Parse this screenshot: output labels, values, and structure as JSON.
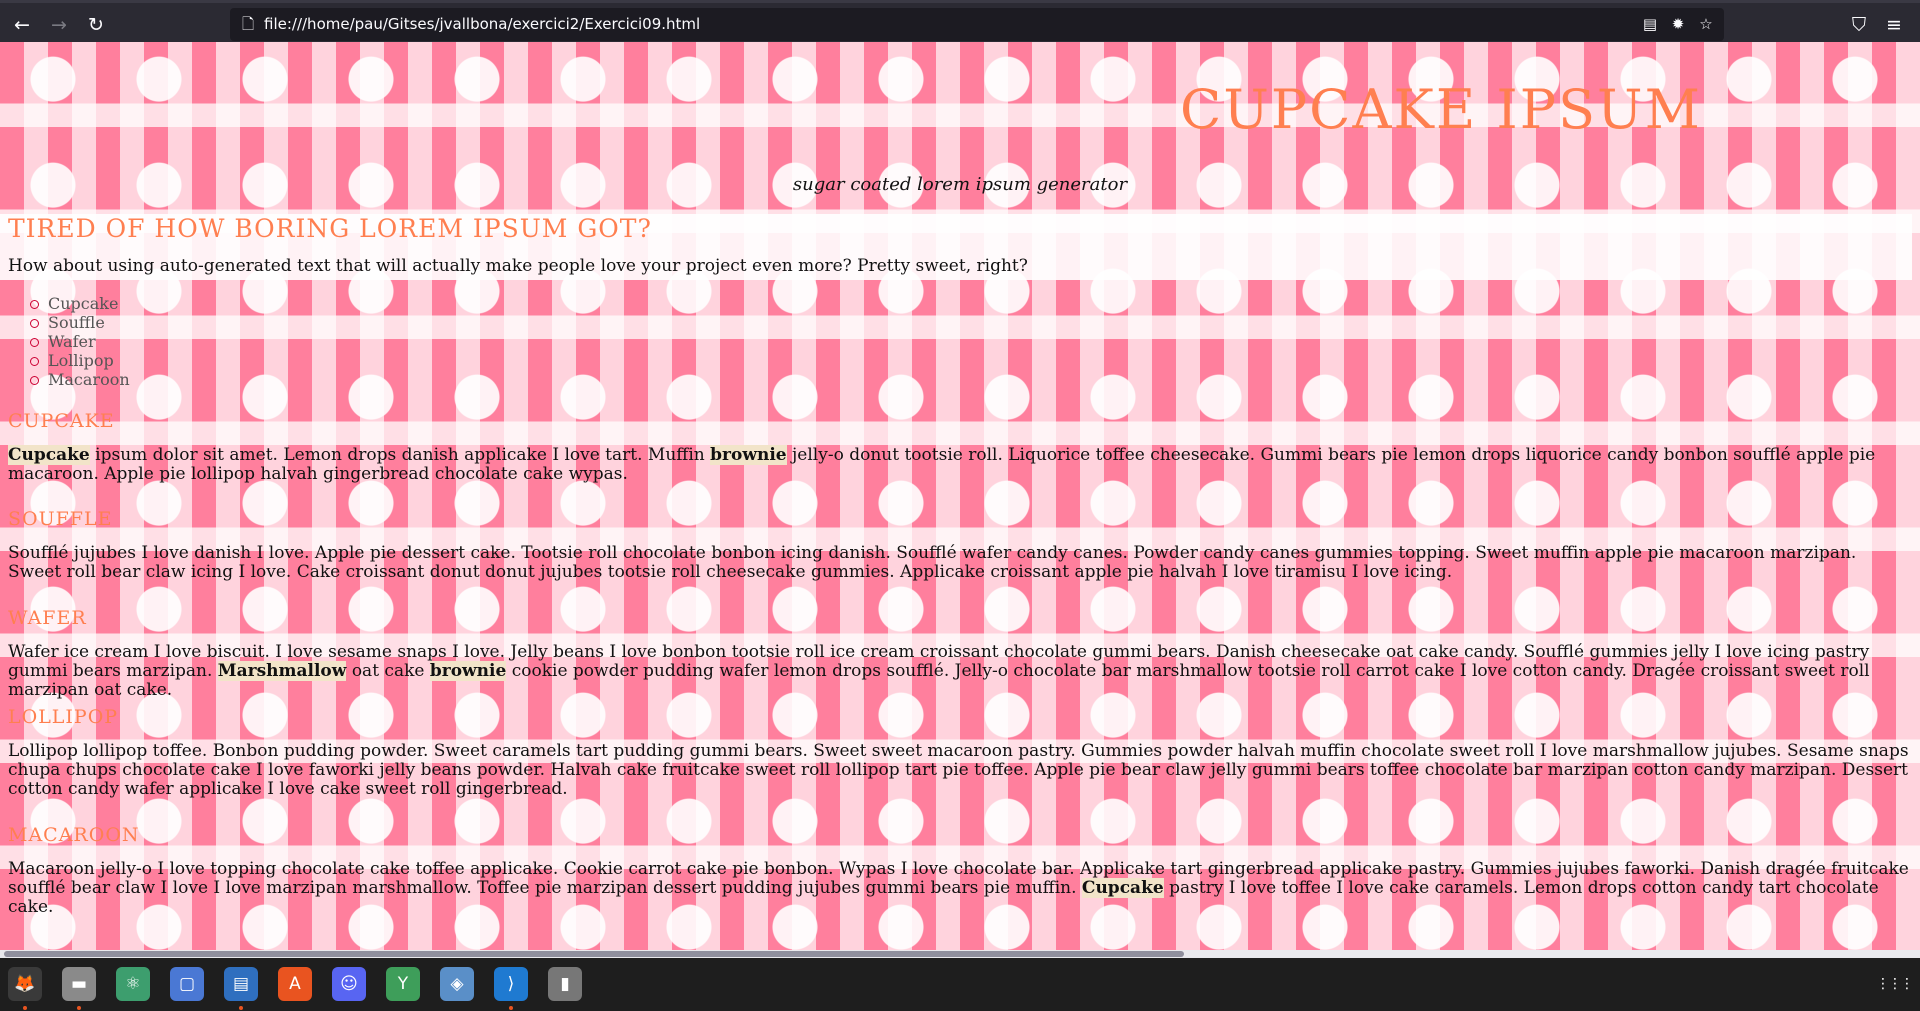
{
  "browser": {
    "url": "file:///home/pau/Gitses/jvallbona/exercici2/Exercici09.html",
    "back_glyph": "←",
    "forward_glyph": "→",
    "reload_glyph": "↻",
    "page_icon": "🗋",
    "reader_icon": "▤",
    "extension_icon": "✹",
    "bookmark_icon": "☆",
    "pocket_icon": "⛉",
    "menu_icon": "≡"
  },
  "page": {
    "title": "CUPCAKE IPSUM",
    "tagline": "sugar coated lorem ipsum generator",
    "intro_heading": "TIRED OF HOW BORING LOREM IPSUM GOT?",
    "intro_text": "How about using auto-generated text that will actually make people love your project even more? Pretty sweet, right?",
    "toc": [
      "Cupcake",
      "Souffle",
      "Wafer",
      "Lollipop",
      "Macaroon"
    ],
    "sections": [
      {
        "heading": "CUPCAKE",
        "p1": "Cupcake",
        "p2": " ipsum dolor sit amet. Lemon drops danish applicake I love tart. Muffin ",
        "p3": "brownie",
        "p4": " jelly-o donut tootsie roll. Liquorice toffee cheesecake. Gummi bears pie lemon drops liquorice candy bonbon soufflé apple pie macaroon. Apple pie lollipop halvah gingerbread chocolate cake wypas."
      },
      {
        "heading": "SOUFFLE",
        "text": "Soufflé jujubes I love danish I love. Apple pie dessert cake. Tootsie roll chocolate bonbon icing danish. Soufflé wafer candy canes. Powder candy canes gummies topping. Sweet muffin apple pie macaroon marzipan. Sweet roll bear claw icing I love. Cake croissant donut donut jujubes tootsie roll cheesecake gummies. Applicake croissant apple pie halvah I love tiramisu I love icing."
      },
      {
        "heading": "WAFER",
        "p1": "Wafer ice cream I love biscuit. I love sesame snaps I love. Jelly beans I love bonbon tootsie roll ice cream croissant chocolate gummi bears. Danish cheesecake oat cake candy. Soufflé gummies jelly I love icing pastry gummi bears marzipan. ",
        "p2": "Marshmallow",
        "p3": " oat cake ",
        "p4": "brownie",
        "p5": " cookie powder pudding wafer lemon drops soufflé. Jelly-o chocolate bar marshmallow tootsie roll carrot cake I love cotton candy. Dragée croissant sweet roll marzipan oat cake."
      },
      {
        "heading": "LOLLIPOP",
        "text": "Lollipop lollipop toffee. Bonbon pudding powder. Sweet caramels tart pudding gummi bears. Sweet sweet macaroon pastry. Gummies powder halvah muffin chocolate sweet roll I love marshmallow jujubes. Sesame snaps chupa chups chocolate cake I love faworki jelly beans powder. Halvah cake fruitcake sweet roll lollipop tart pie toffee. Apple pie bear claw jelly gummi bears toffee chocolate bar marzipan cotton candy marzipan. Dessert cotton candy wafer applicake I love cake sweet roll gingerbread."
      },
      {
        "heading": "MACAROON",
        "p1": "Macaroon jelly-o I love topping chocolate cake toffee applicake. Cookie carrot cake pie bonbon. Wypas I love chocolate bar. Applicake tart gingerbread applicake pastry. Gummies jujubes faworki. Danish dragée fruitcake soufflé bear claw I love I love marzipan marshmallow. Toffee pie marzipan dessert pudding jujubes gummi bears pie muffin. ",
        "p2": "Cupcake",
        "p3": " pastry I love toffee I love cake caramels. Lemon drops cotton candy tart chocolate cake."
      }
    ]
  },
  "taskbar": {
    "apps": [
      {
        "name": "firefox-icon",
        "glyph": "🦊",
        "color": "#3a3a3a"
      },
      {
        "name": "files-icon",
        "glyph": "▬",
        "color": "#8a8a8a"
      },
      {
        "name": "atom-icon",
        "glyph": "⚛",
        "color": "#3d9e6e"
      },
      {
        "name": "screenshot-icon",
        "glyph": "▢",
        "color": "#4a78d4"
      },
      {
        "name": "text-editor-icon",
        "glyph": "▤",
        "color": "#2f6fbf"
      },
      {
        "name": "software-center-icon",
        "glyph": "A",
        "color": "#e95420"
      },
      {
        "name": "discord-icon",
        "glyph": "☺",
        "color": "#5865f2"
      },
      {
        "name": "gitkraken-icon",
        "glyph": "Y",
        "color": "#3e9e5a"
      },
      {
        "name": "virtualbox-icon",
        "glyph": "◈",
        "color": "#5a8fc8"
      },
      {
        "name": "vscode-icon",
        "glyph": "⟩",
        "color": "#1f7ad1"
      },
      {
        "name": "usb-drive-icon",
        "glyph": "▮",
        "color": "#777777"
      }
    ],
    "show_apps_glyph": "⋮⋮⋮"
  }
}
